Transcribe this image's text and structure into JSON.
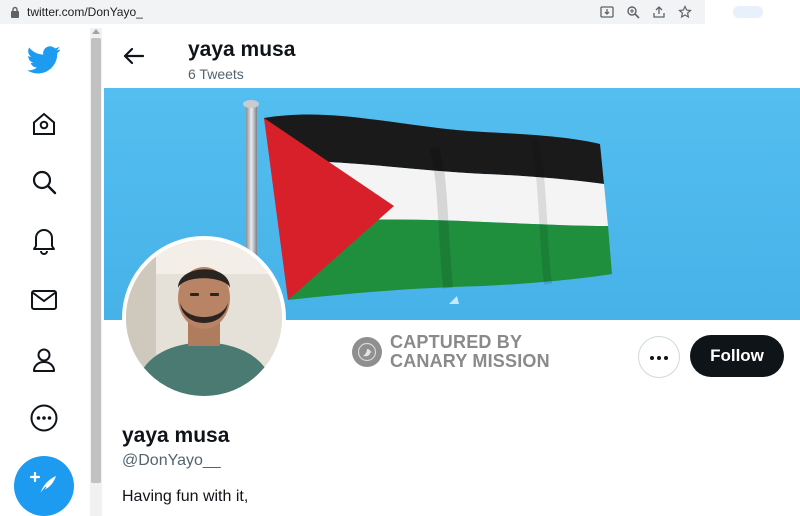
{
  "browser": {
    "url": "twitter.com/DonYayo_"
  },
  "nav": {
    "items": [
      "twitter-logo",
      "home-icon",
      "search-icon",
      "bell-icon",
      "mail-icon",
      "profile-icon",
      "more-icon"
    ],
    "compose_icon": "feather-plus-icon"
  },
  "header": {
    "name": "yaya musa",
    "tweet_count": "6 Tweets"
  },
  "watermark": {
    "line1": "CAPTURED BY",
    "line2": "CANARY MISSION"
  },
  "actions": {
    "more_label": "•••",
    "follow_label": "Follow"
  },
  "profile": {
    "name": "yaya musa",
    "handle": "@DonYayo__",
    "bio": "Having fun with it,"
  },
  "colors": {
    "accent": "#1d9bf0",
    "banner_sky": "#4cb8ee",
    "follow_button": "#0f1419"
  }
}
